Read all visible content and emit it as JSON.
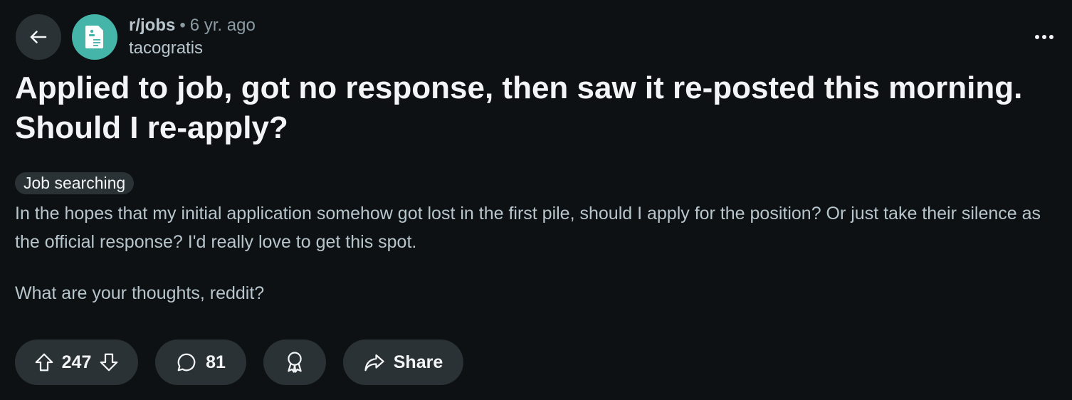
{
  "header": {
    "back_icon": "arrow-left-icon",
    "subreddit": "r/jobs",
    "separator": "•",
    "age": "6 yr. ago",
    "author": "tacogratis",
    "more_icon": "more-horizontal-icon"
  },
  "post": {
    "title": "Applied to job, got no response, then saw it re-posted this morning. Should I re-apply?",
    "flair": "Job searching",
    "paragraphs": [
      "In the hopes that my initial application somehow got lost in the first pile, should I apply for the position? Or just take their silence as the official response? I'd really love to get this spot.",
      "What are your thoughts, reddit?"
    ]
  },
  "actions": {
    "score": "247",
    "comments": "81",
    "share_label": "Share",
    "upvote_icon": "arrow-up-icon",
    "downvote_icon": "arrow-down-icon",
    "comment_icon": "speech-bubble-icon",
    "award_icon": "award-icon",
    "share_icon": "share-arrow-icon"
  },
  "colors": {
    "background": "#0e1113",
    "pill": "#2a3236",
    "avatar": "#46b5a9",
    "secondary_text": "#b7c5cc"
  }
}
